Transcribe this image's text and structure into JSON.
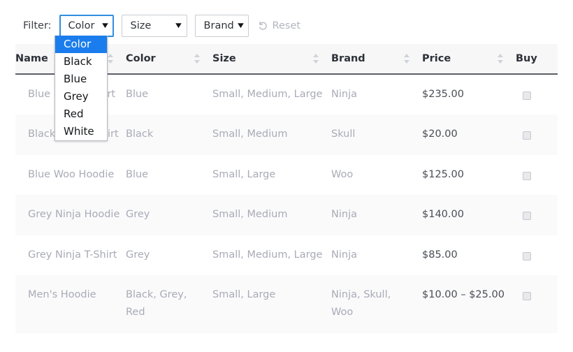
{
  "filter": {
    "label": "Filter:",
    "selects": [
      {
        "name": "color",
        "value": "Color",
        "focused": true
      },
      {
        "name": "size",
        "value": "Size",
        "focused": false
      },
      {
        "name": "brand",
        "value": "Brand",
        "focused": false
      }
    ],
    "reset": {
      "label": "Reset",
      "icon": "undo-arrow-icon"
    }
  },
  "dropdown": {
    "open_for": "color",
    "selected": "Color",
    "options": [
      "Color",
      "Black",
      "Blue",
      "Grey",
      "Red",
      "White"
    ]
  },
  "table": {
    "columns": [
      "Name",
      "Color",
      "Size",
      "Brand",
      "Price",
      "Buy"
    ],
    "sort_icon": "sort-updown-icon",
    "rows": [
      {
        "name": "Blue Ninja T-Shirt",
        "color": "Blue",
        "size": "Small, Medium, Large",
        "brand": "Ninja",
        "price": "$235.00",
        "buy": "checkbox"
      },
      {
        "name": "Black Skull T-Shirt",
        "color": "Black",
        "size": "Small, Medium",
        "brand": "Skull",
        "price": "$20.00",
        "buy": "checkbox"
      },
      {
        "name": "Blue Woo Hoodie",
        "color": "Blue",
        "size": "Small, Large",
        "brand": "Woo",
        "price": "$125.00",
        "buy": "checkbox"
      },
      {
        "name": "Grey Ninja Hoodie",
        "color": "Grey",
        "size": "Small, Medium",
        "brand": "Ninja",
        "price": "$140.00",
        "buy": "checkbox"
      },
      {
        "name": "Grey Ninja T-Shirt",
        "color": "Grey",
        "size": "Small, Medium, Large",
        "brand": "Ninja",
        "price": "$85.00",
        "buy": "checkbox"
      },
      {
        "name": "Men's Hoodie",
        "color": "Black, Grey, Red",
        "size": "Small, Large",
        "brand": "Ninja, Skull, Woo",
        "price": "$10.00 – $25.00",
        "buy": "checkbox"
      }
    ]
  },
  "colors": {
    "accent": "#1b7ded",
    "focus_border": "#2e8fe0",
    "header_bg": "#f7f7f8",
    "header_text": "#2d3138",
    "row_text": "#a9abb6",
    "price_text": "#4a4d55",
    "stripe": "#fafafb"
  }
}
